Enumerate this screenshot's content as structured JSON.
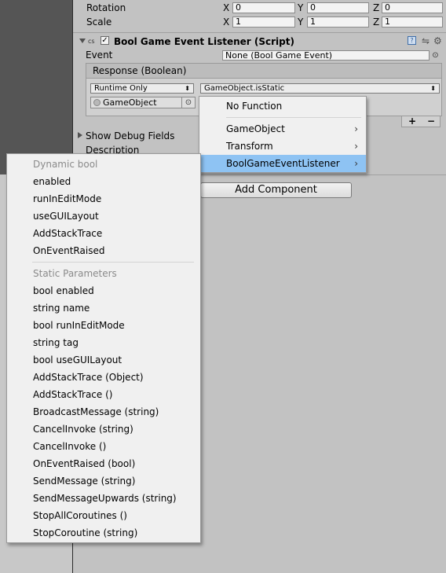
{
  "transform": {
    "rotation": {
      "label": "Rotation",
      "x": "0",
      "y": "0",
      "z": "0"
    },
    "scale": {
      "label": "Scale",
      "x": "1",
      "y": "1",
      "z": "1"
    },
    "axes": {
      "x": "X",
      "y": "Y",
      "z": "Z"
    }
  },
  "component": {
    "title": "Bool Game Event Listener (Script)",
    "event_label": "Event",
    "event_value": "None (Bool Game Event)",
    "response_header": "Response (Boolean)",
    "runtime_dropdown": "Runtime Only",
    "function_dropdown": "GameObject.isStatic",
    "object_field": "GameObject",
    "plus": "+",
    "minus": "−",
    "debug_fields": "Show Debug Fields",
    "description": "Description"
  },
  "add_component": "Add Component",
  "popup_menu": {
    "items": [
      {
        "label": "No Function",
        "submenu": false
      },
      {
        "label": "GameObject",
        "submenu": true
      },
      {
        "label": "Transform",
        "submenu": true
      },
      {
        "label": "BoolGameEventListener",
        "submenu": true,
        "selected": true
      }
    ]
  },
  "submenu": {
    "dynamic_header": "Dynamic bool",
    "dynamic_items": [
      "enabled",
      "runInEditMode",
      "useGUILayout",
      "AddStackTrace",
      "OnEventRaised"
    ],
    "static_header": "Static Parameters",
    "static_items": [
      "bool enabled",
      "string name",
      "bool runInEditMode",
      "string tag",
      "bool useGUILayout",
      "AddStackTrace (Object)",
      "AddStackTrace ()",
      "BroadcastMessage (string)",
      "CancelInvoke (string)",
      "CancelInvoke ()",
      "OnEventRaised (bool)",
      "SendMessage (string)",
      "SendMessageUpwards (string)",
      "StopAllCoroutines ()",
      "StopCoroutine (string)"
    ]
  },
  "colors": {
    "selection": "#8ec3f3",
    "inspector_bg": "#c2c2c2",
    "scene_bg": "#555555"
  }
}
